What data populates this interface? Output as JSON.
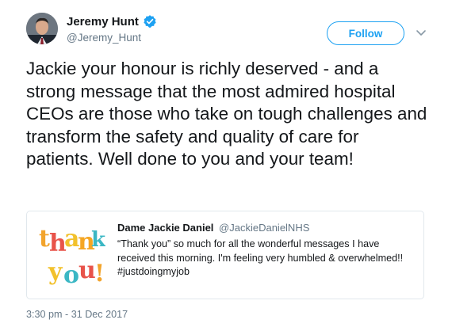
{
  "author": {
    "display_name": "Jeremy Hunt",
    "handle": "@Jeremy_Hunt",
    "verified_icon": "verified-badge-icon"
  },
  "follow_label": "Follow",
  "tweet": {
    "text": "Jackie your honour is richly deserved - and a strong message that the most admired hospital CEOs are those who take on tough challenges and transform the safety and quality of care for patients. Well done to you and your team!",
    "timestamp": "3:30 pm - 31 Dec 2017"
  },
  "quoted_tweet": {
    "display_name": "Dame Jackie Daniel",
    "handle": "@JackieDanielNHS",
    "text": "“Thank you” so much for all the wonderful messages I have received this morning. I'm feeling very humbled & overwhelmed!! #justdoingmyjob",
    "image_text": "thank you!"
  },
  "colors": {
    "accent": "#1da1f2",
    "secondary_text": "#657786",
    "border": "#e1e8ed"
  }
}
